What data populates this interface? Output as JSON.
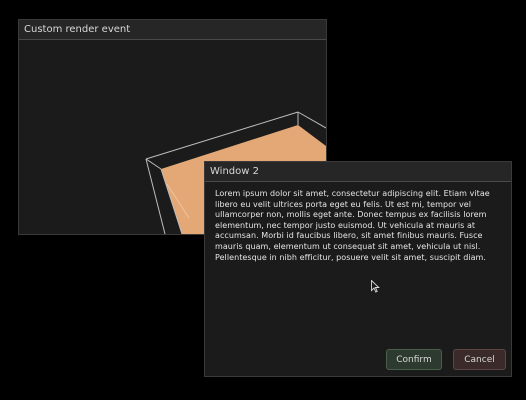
{
  "windows": [
    {
      "title": "Custom render event",
      "scene": {
        "shape_color": "#e4a877",
        "wireframe_color": "#bdbdbd"
      }
    },
    {
      "title": "Window 2",
      "body": "Lorem ipsum dolor sit amet, consectetur adipiscing elit. Etiam vitae libero eu velit ultrices porta eget eu felis. Ut est mi, tempor vel ullamcorper non, mollis eget ante. Donec tempus ex facilisis lorem elementum, nec tempor justo euismod. Ut vehicula at mauris at accumsan. Morbi id faucibus libero, sit amet finibus mauris. Fusce mauris quam, elementum ut consequat sit amet, vehicula ut nisl. Pellentesque in nibh efficitur, posuere velit sit amet, suscipit diam.",
      "confirm_label": "Confirm",
      "cancel_label": "Cancel"
    }
  ],
  "colors": {
    "confirm_bg": "#2d3a2f",
    "cancel_bg": "#3a2a2a"
  },
  "cursor": "arrow-pointer-icon"
}
